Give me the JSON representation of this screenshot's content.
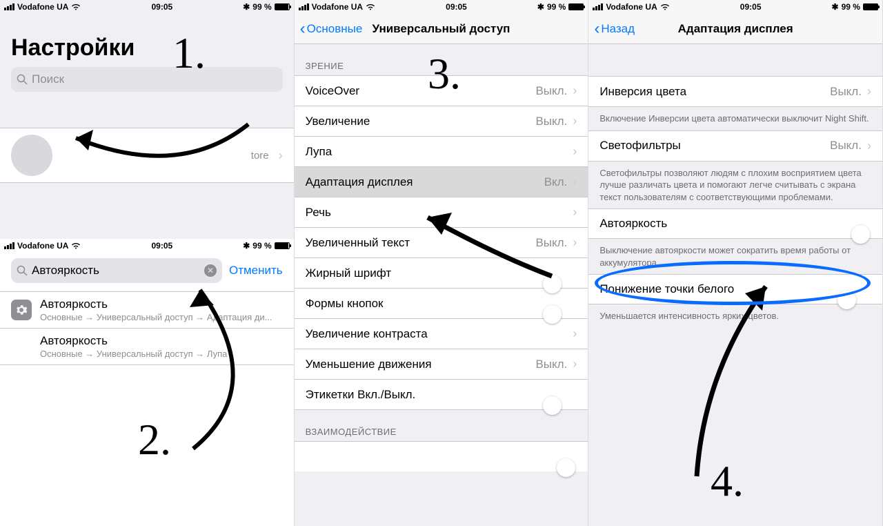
{
  "status": {
    "carrier": "Vodafone UA",
    "time": "09:05",
    "battery_pct": "99 %"
  },
  "panel1": {
    "top_title": "Настройки",
    "search_placeholder": "Поиск",
    "profile_tail": "tore",
    "search_value": "Автояркость",
    "cancel": "Отменить",
    "results": [
      {
        "title": "Автояркость",
        "path": "Основные → Универсальный доступ → Адаптация ди..."
      },
      {
        "title": "Автояркость",
        "path": "Основные → Универсальный доступ → Лупа"
      }
    ]
  },
  "panel2": {
    "back": "Основные",
    "title": "Универсальный доступ",
    "section_vision": "ЗРЕНИЕ",
    "section_interaction": "ВЗАИМОДЕЙСТВИЕ",
    "rows": {
      "voiceover": {
        "label": "VoiceOver",
        "value": "Выкл."
      },
      "zoom": {
        "label": "Увеличение",
        "value": "Выкл."
      },
      "magnifier": {
        "label": "Лупа",
        "value": ""
      },
      "display": {
        "label": "Адаптация дисплея",
        "value": "Вкл."
      },
      "speech": {
        "label": "Речь",
        "value": ""
      },
      "larger": {
        "label": "Увеличенный текст",
        "value": "Выкл."
      },
      "bold": {
        "label": "Жирный шрифт"
      },
      "shapes": {
        "label": "Формы кнопок"
      },
      "contrast": {
        "label": "Увеличение контраста",
        "value": ""
      },
      "motion": {
        "label": "Уменьшение движения",
        "value": "Выкл."
      },
      "labels": {
        "label": "Этикетки Вкл./Выкл."
      }
    }
  },
  "panel3": {
    "back": "Назад",
    "title": "Адаптация дисплея",
    "rows": {
      "invert": {
        "label": "Инверсия цвета",
        "value": "Выкл."
      },
      "invert_footer": "Включение Инверсии цвета автоматически выключит Night Shift.",
      "filters": {
        "label": "Светофильтры",
        "value": "Выкл."
      },
      "filters_footer": "Светофильтры позволяют людям с плохим восприятием цвета лучше различать цвета и помогают легче считывать с экрана текст пользователям с соответствующими проблемами.",
      "auto": {
        "label": "Автояркость"
      },
      "auto_footer": "Выключение автояркости может сократить время работы от аккумулятора.",
      "white": {
        "label": "Понижение точки белого"
      },
      "white_footer": "Уменьшается интенсивность ярких цветов."
    }
  },
  "steps": {
    "s1": "1.",
    "s2": "2.",
    "s3": "3.",
    "s4": "4."
  }
}
